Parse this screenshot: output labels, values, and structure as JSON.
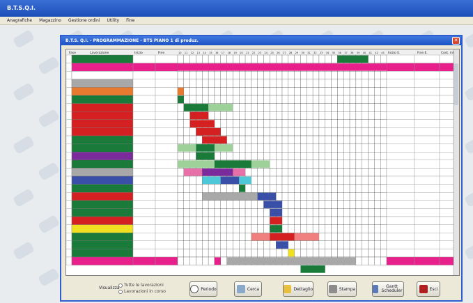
{
  "app": {
    "title": "B.T.S.Q.I.",
    "menu": [
      "Anagrafiche",
      "Magazzino",
      "Gestione ordini",
      "Utility",
      "Fine"
    ]
  },
  "window": {
    "title": "B.T.S. Q.I. - PROGRAMMAZIONE - BTS PIANO 1 di produz."
  },
  "columns": {
    "fase": "Fase",
    "lavorazione": "Lavorazione",
    "inizio": "Inizio",
    "fine": "Fine",
    "inizio_e": "Inizio E.",
    "fine_e": "Fine E.",
    "cost": "Cost. int.",
    "ok": "OK"
  },
  "bottom": {
    "view_label": "Visualizza",
    "view_options": [
      "Tutte le lavorazioni",
      "Lavorazioni in corso"
    ],
    "buttons": [
      {
        "id": "periodo",
        "label": "Periodo",
        "icon": "clock-icon",
        "color": "#c0c0c0"
      },
      {
        "id": "cerca",
        "label": "Cerca",
        "icon": "search-icon",
        "color": "#8aa8c8"
      },
      {
        "id": "dettaglio",
        "label": "Dettaglio",
        "icon": "edit-icon",
        "color": "#e8c040"
      },
      {
        "id": "stampa",
        "label": "Stampa",
        "icon": "print-icon",
        "color": "#8c8c8c"
      },
      {
        "id": "gantt",
        "label": "Gantt Scheduler",
        "icon": "gantt-icon",
        "color": "#5a7ab8"
      },
      {
        "id": "esci",
        "label": "Esci",
        "icon": "exit-icon",
        "color": "#b02020"
      }
    ]
  },
  "colors": {
    "magenta": "#e8208c",
    "green": "#1a7a3a",
    "red": "#d42020",
    "grey": "#a8a8a8"
  }
}
